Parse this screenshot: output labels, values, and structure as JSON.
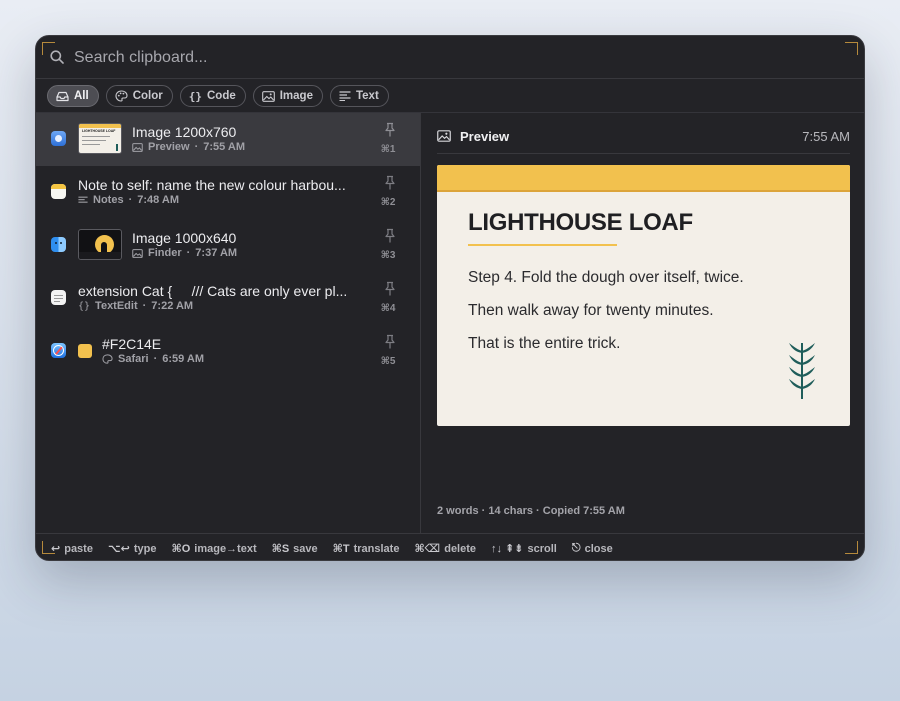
{
  "search": {
    "placeholder": "Search clipboard..."
  },
  "filters": [
    {
      "label": "All",
      "icon": "tray-icon",
      "active": true
    },
    {
      "label": "Color",
      "icon": "palette-icon",
      "active": false
    },
    {
      "label": "Code",
      "icon": "braces-icon",
      "active": false
    },
    {
      "label": "Image",
      "icon": "image-icon",
      "active": false
    },
    {
      "label": "Text",
      "icon": "text-lines-icon",
      "active": false
    }
  ],
  "items": [
    {
      "title": "Image 1200x760",
      "app": "Preview",
      "time": "7:55 AM",
      "shortcut": "⌘1",
      "type_icon": "image-icon",
      "app_icon": "preview-app-icon",
      "selected": true,
      "thumb_title": "LIGHTHOUSE LOAF"
    },
    {
      "title": "Note to self: name the new colour harbou...",
      "app": "Notes",
      "time": "7:48 AM",
      "shortcut": "⌘2",
      "type_icon": "text-lines-icon",
      "app_icon": "notes-app-icon",
      "selected": false
    },
    {
      "title": "Image 1000x640",
      "app": "Finder",
      "time": "7:37 AM",
      "shortcut": "⌘3",
      "type_icon": "image-icon",
      "app_icon": "finder-app-icon",
      "selected": false
    },
    {
      "title": "extension Cat {     /// Cats are only ever pl...",
      "app": "TextEdit",
      "time": "7:22 AM",
      "shortcut": "⌘4",
      "type_icon": "braces-icon",
      "app_icon": "textedit-app-icon",
      "selected": false
    },
    {
      "title": "#F2C14E",
      "app": "Safari",
      "time": "6:59 AM",
      "shortcut": "⌘5",
      "type_icon": "palette-icon",
      "app_icon": "safari-app-icon",
      "selected": false,
      "swatch": "#F2C14E"
    }
  ],
  "separator": "·",
  "preview": {
    "label": "Preview",
    "time": "7:55 AM",
    "card": {
      "title": "LIGHTHOUSE LOAF",
      "lines": [
        "Step 4. Fold the dough over itself, twice.",
        "Then walk away for twenty minutes.",
        "That is the entire trick."
      ],
      "accent": "#F2C14E",
      "leaf_color": "#1f5d5a"
    },
    "stats": "2 words · 14 chars  ·  Copied 7:55 AM"
  },
  "footer": {
    "hints": [
      {
        "key": "↩",
        "label": "paste"
      },
      {
        "key": "⌥↩",
        "label": "type"
      },
      {
        "key": "⌘O",
        "label": "image→text"
      },
      {
        "key": "⌘S",
        "label": "save"
      },
      {
        "key": "⌘T",
        "label": "translate"
      },
      {
        "key": "⌘⌫",
        "label": "delete"
      },
      {
        "key": "↑↓ ⇞⇟",
        "label": "scroll"
      },
      {
        "key": "⎋",
        "label": "close"
      }
    ]
  },
  "colors": {
    "background": "#232327",
    "accent": "#F2C14E",
    "selected_row": "#3a3a3f"
  }
}
